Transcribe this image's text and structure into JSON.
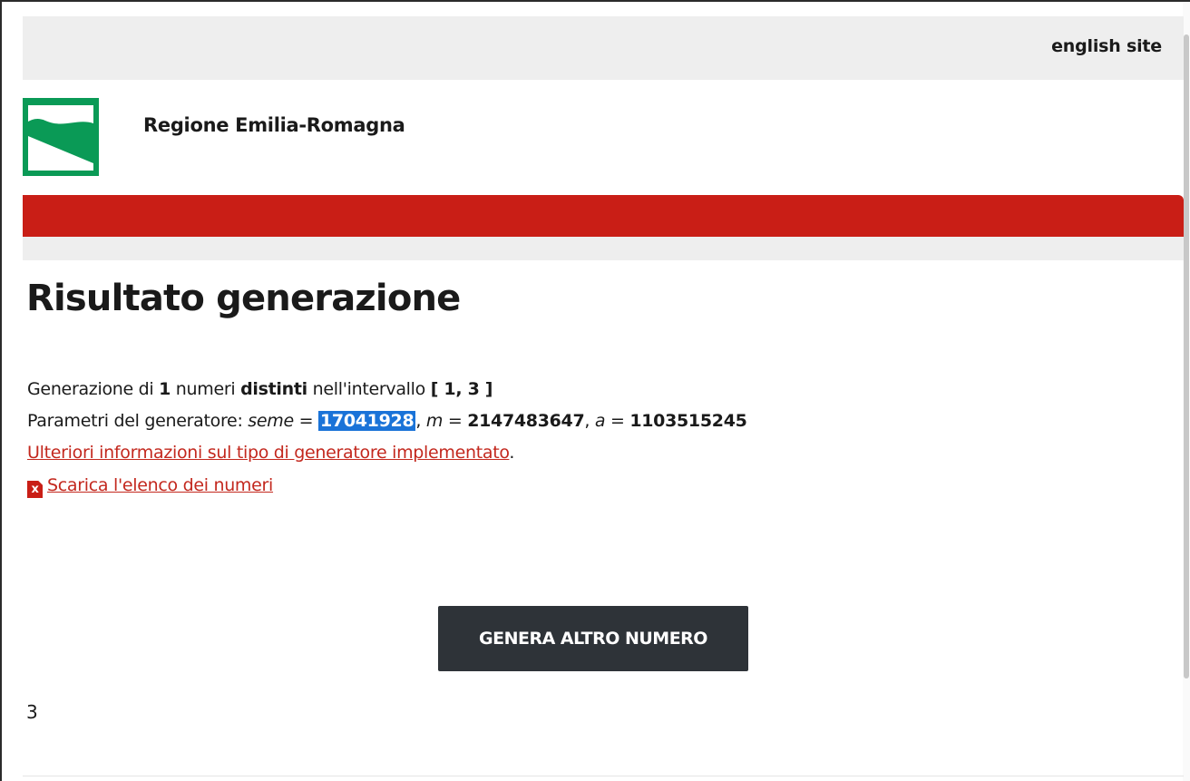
{
  "header": {
    "english_link": "english site",
    "region_name": "Regione Emilia-Romagna"
  },
  "page_title": "Risultato generazione",
  "summary": {
    "prefix": "Generazione di ",
    "count": "1",
    "mid1": " numeri ",
    "distinct": "distinti",
    "mid2": " nell'intervallo ",
    "interval": "[ 1, 3 ]"
  },
  "params": {
    "prefix": "Parametri del generatore: ",
    "seed_label": "seme",
    "seed_value": "17041928",
    "m_label": "m",
    "m_value": "2147483647",
    "a_label": "a",
    "a_value": "1103515245",
    "equals": " = ",
    "sep": ", "
  },
  "info_link": {
    "label": "Ulteriori informazioni sul tipo di generatore implementato",
    "suffix": "."
  },
  "download_link": {
    "icon_letter": "x",
    "label": "Scarica l'elenco dei numeri"
  },
  "generate_button": "GENERA ALTRO NUMERO",
  "result": "3",
  "colors": {
    "brand_green": "#0a9a56",
    "brand_red": "#c91e16",
    "link_red": "#c3281e",
    "button_dark": "#2e3338",
    "selection_blue": "#1a73d8"
  }
}
